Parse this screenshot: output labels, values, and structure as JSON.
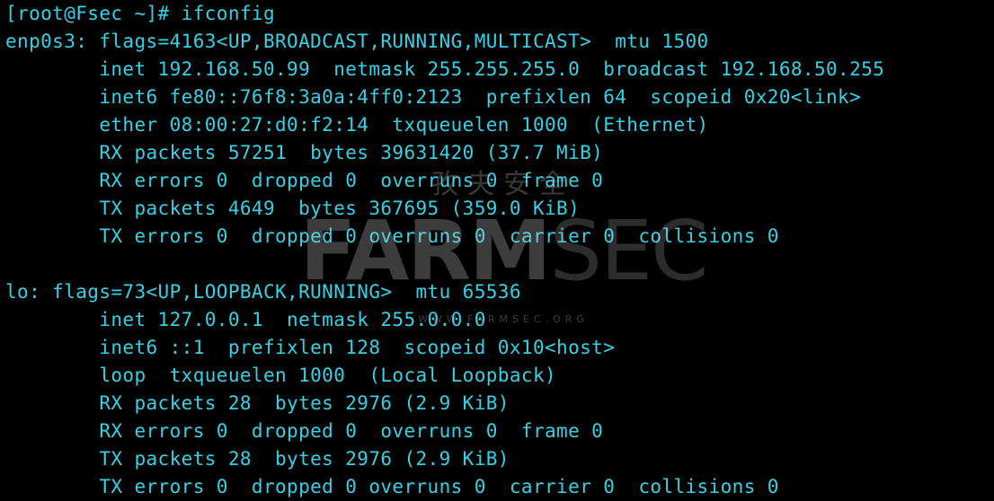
{
  "terminal": {
    "lines": [
      "[root@Fsec ~]# ifconfig",
      "enp0s3: flags=4163<UP,BROADCAST,RUNNING,MULTICAST>  mtu 1500",
      "        inet 192.168.50.99  netmask 255.255.255.0  broadcast 192.168.50.255",
      "        inet6 fe80::76f8:3a0a:4ff0:2123  prefixlen 64  scopeid 0x20<link>",
      "        ether 08:00:27:d0:f2:14  txqueuelen 1000  (Ethernet)",
      "        RX packets 57251  bytes 39631420 (37.7 MiB)",
      "        RX errors 0  dropped 0  overruns 0  frame 0",
      "        TX packets 4649  bytes 367695 (359.0 KiB)",
      "        TX errors 0  dropped 0 overruns 0  carrier 0  collisions 0",
      "",
      "lo: flags=73<UP,LOOPBACK,RUNNING>  mtu 65536",
      "        inet 127.0.0.1  netmask 255.0.0.0",
      "        inet6 ::1  prefixlen 128  scopeid 0x10<host>",
      "        loop  txqueuelen 1000  (Local Loopback)",
      "        RX packets 28  bytes 2976 (2.9 KiB)",
      "        RX errors 0  dropped 0  overruns 0  frame 0",
      "        TX packets 28  bytes 2976 (2.9 KiB)",
      "        TX errors 0  dropped 0 overruns 0  carrier 0  collisions 0"
    ]
  },
  "watermark": {
    "chinese": "孜夫安全",
    "logo_bold": "FARM",
    "logo_light": "SEC",
    "url": "WWW.FARMSEC.ORG"
  },
  "colors": {
    "background": "#000000",
    "text": "#35d1e6"
  }
}
